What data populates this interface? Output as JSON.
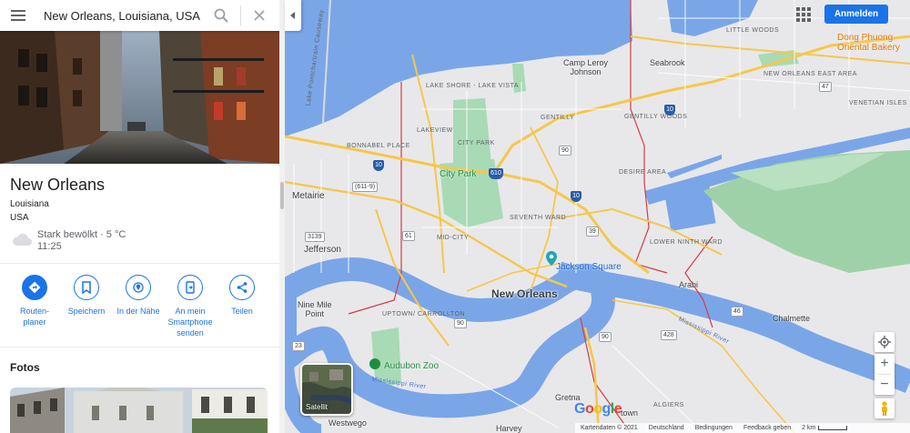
{
  "search": {
    "value": "New Orleans, Louisiana, USA",
    "menu_icon": "hamburger-menu-icon",
    "search_icon": "magnifier-icon",
    "clear_icon": "close-x-icon"
  },
  "place": {
    "title": "New Orleans",
    "region": "Louisiana",
    "country": "USA",
    "weather": {
      "icon": "cloud-icon",
      "description": "Stark bewölkt · 5 °C",
      "time": "11:25"
    }
  },
  "actions": [
    {
      "label": "Routen-\nplaner",
      "icon": "directions-icon"
    },
    {
      "label": "Speichern",
      "icon": "bookmark-icon"
    },
    {
      "label": "In der Nähe",
      "icon": "nearby-icon"
    },
    {
      "label": "An mein\nSmartphone\nsenden",
      "icon": "send-to-phone-icon"
    },
    {
      "label": "Teilen",
      "icon": "share-icon"
    }
  ],
  "photos": {
    "heading": "Fotos"
  },
  "map": {
    "signin_label": "Anmelden",
    "satellite_label": "Satellit",
    "google_logo": "Google",
    "attribution": "Kartendaten © 2021",
    "footer_links": [
      "Deutschland",
      "Bedingungen",
      "Feedback geben"
    ],
    "scale_label": "2 km",
    "labels": {
      "new_orleans": "New Orleans",
      "metairie": "Metairie",
      "jefferson": "Jefferson",
      "nine_mile_point": "Nine Mile\nPoint",
      "camp_leroy_johnson": "Camp Leroy\nJohnson",
      "seabrook": "Seabrook",
      "arabi": "Arabi",
      "chalmette": "Chalmette",
      "gretna": "Gretna",
      "harvey": "Harvey",
      "westwego": "Westwego",
      "city_park": "City Park",
      "audubon_zoo": "Audubon Zoo",
      "jackson_square": "Jackson Square",
      "dong_phuong": "Dong Phuong\nOriental Bakery",
      "lake_shore": "LAKE SHORE\n- LAKE VISTA",
      "gentilly": "GENTILLY",
      "gentilly_woods": "GENTILLY\nWOODS",
      "lakeview": "LAKEVIEW",
      "city_park_hood": "CITY PARK",
      "bonnabel": "BONNABEL\nPLACE",
      "desire_area": "DESIRE AREA",
      "seventh_ward": "SEVENTH WARD",
      "mid_city": "MID-CITY",
      "uptown": "UPTOWN/\nCARROLLTON",
      "lower_ninth": "LOWER\nNINTH WARD",
      "ne_east_area": "NEW ORLEANS\nEAST AREA",
      "little_woods": "LITTLE WOODS",
      "venetian_isles": "VENETIAN ISLES",
      "algiers": "ALGIERS",
      "mississippi_river": "Mississippi River",
      "lake_causeway": "Lake Pontchartrain Causeway",
      "town_suffix": "town"
    },
    "shields": {
      "i10": "10",
      "i610": "610",
      "r90": "90",
      "r611": "(611-9)",
      "r3139": "3139",
      "r61": "61",
      "r39": "39",
      "r428": "428",
      "r46": "46",
      "r47": "47",
      "r23": "23",
      "r90b": "90"
    },
    "colors": {
      "land": "#e8e8ea",
      "water": "#7aa6e8",
      "park": "#a8dab5",
      "highway": "#f6c74a",
      "boundary": "#d93a46",
      "accent": "#1a73e8"
    }
  }
}
